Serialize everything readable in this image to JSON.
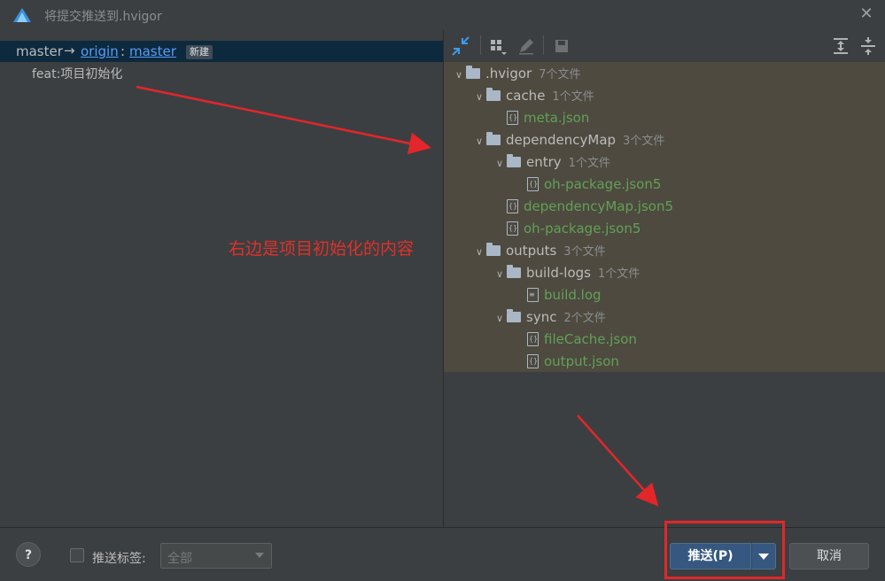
{
  "window": {
    "title": "将提交推送到.hvigor",
    "close_icon": "close-icon"
  },
  "left": {
    "branch": {
      "local": "master",
      "arrow": "→",
      "remote": "origin",
      "colon": ":",
      "target": "master",
      "badge": "新建"
    },
    "commits": [
      "feat:项目初始化"
    ]
  },
  "toolbar": {
    "icons": [
      "expand-changes-icon",
      "group-by-icon",
      "edit-icon",
      "save-icon",
      "expand-all-icon",
      "collapse-all-icon"
    ]
  },
  "tree": [
    {
      "level": 0,
      "type": "folder",
      "name": ".hvigor",
      "count": "7个文件",
      "expanded": true
    },
    {
      "level": 1,
      "type": "folder",
      "name": "cache",
      "count": "1个文件",
      "expanded": true
    },
    {
      "level": 2,
      "type": "file",
      "name": "meta.json"
    },
    {
      "level": 1,
      "type": "folder",
      "name": "dependencyMap",
      "count": "3个文件",
      "expanded": true
    },
    {
      "level": 2,
      "type": "folder",
      "name": "entry",
      "count": "1个文件",
      "expanded": true
    },
    {
      "level": 3,
      "type": "file",
      "name": "oh-package.json5"
    },
    {
      "level": 2,
      "type": "file",
      "name": "dependencyMap.json5"
    },
    {
      "level": 2,
      "type": "file",
      "name": "oh-package.json5"
    },
    {
      "level": 1,
      "type": "folder",
      "name": "outputs",
      "count": "3个文件",
      "expanded": true
    },
    {
      "level": 2,
      "type": "folder",
      "name": "build-logs",
      "count": "1个文件",
      "expanded": true
    },
    {
      "level": 3,
      "type": "file",
      "name": "build.log",
      "icon": "log"
    },
    {
      "level": 2,
      "type": "folder",
      "name": "sync",
      "count": "2个文件",
      "expanded": true
    },
    {
      "level": 3,
      "type": "file",
      "name": "fileCache.json"
    },
    {
      "level": 3,
      "type": "file",
      "name": "output.json"
    }
  ],
  "annotation": {
    "text": "右边是项目初始化的内容",
    "color": "#e0302a"
  },
  "bottom": {
    "help": "?",
    "push_tags_label": "推送标签:",
    "tags_select_value": "全部",
    "push_button": "推送(P)",
    "cancel_button": "取消"
  },
  "colors": {
    "accent": "#365880",
    "file_green": "#62a058",
    "highlight_red": "#e3262a"
  }
}
